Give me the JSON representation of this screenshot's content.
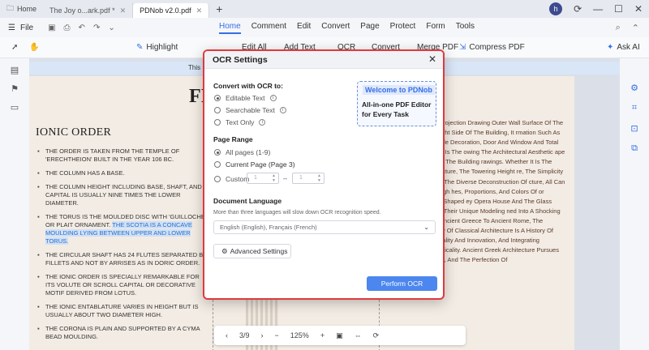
{
  "titlebar": {
    "home_label": "Home",
    "tabs": [
      {
        "label": "The Joy o...ark.pdf *"
      },
      {
        "label": "PDNob v2.0.pdf"
      }
    ],
    "avatar_letter": "h"
  },
  "menubar": {
    "file_label": "File",
    "menus": [
      "Home",
      "Comment",
      "Edit",
      "Convert",
      "Page",
      "Protect",
      "Form",
      "Tools"
    ],
    "active_menu": "Home"
  },
  "toolbar": {
    "highlight": "Highlight",
    "edit_all": "Edit All",
    "add_text": "Add Text",
    "ocr": "OCR",
    "convert": "Convert",
    "merge_pdf": "Merge PDF",
    "compress_pdf": "Compress PDF",
    "ask_ai": "Ask AI"
  },
  "document": {
    "notice": "This PD",
    "title": "FI",
    "heading": "IONIC ORDER",
    "bullets": [
      {
        "text": "THE ORDER IS TAKEN FROM THE TEMPLE OF 'ERECHTHEION' BUILT IN THE YEAR 106 BC."
      },
      {
        "text": "THE COLUMN HAS A BASE."
      },
      {
        "text": "THE COLUMN HEIGHT INCLUDING BASE, SHAFT, AND CAPITAL IS USUALLY NINE TIMES THE LOWER DIAMETER."
      },
      {
        "text": "THE TORUS IS THE MOULDED DISC WITH 'GUILLOCHE' OR PLAIT ORNAMENT.",
        "highlight": "THE SCOTIA IS A CONCAVE MOULDING LYING BETWEEN UPPER AND LOWER TORUS."
      },
      {
        "text": "THE CIRCULAR SHAFT HAS 24 FLUTES SEPARATED BY FILLETS AND NOT BY ARRISES AS IN DORIC ORDER."
      },
      {
        "text": "THE IONIC ORDER IS SPECIALLY REMARKABLE FOR ITS VOLUTE OR SCROLL CAPITAL OR DECORATIVE MOTIF DERIVED FROM LOTUS."
      },
      {
        "text": "THE IONIC ENTABLATURE VARIES IN HEIGHT BUT IS USUALLY ABOUT TWO DIAMETER HIGH."
      },
      {
        "text": "THE CORONA IS PLAIN AND SUPPORTED BY A CYMA BEAD MOULDING."
      }
    ],
    "right_column": "s An Orthographic Projection Drawing Outer Wall Surface Of The Building ; Left Or Right Side Of The Building, It rmation Such As The Building's Facade Decoration, Door And Window And Total Building Height, And Is The owing The Architectural Aesthetic ape The Visual Image Of The Building rawings. Whether It Is The Symmetrical Architecture, The Towering Height re, The Simplicity And Fluency Of , Or The Diverse Deconstruction Of cture, All Can Be Presented Through hes, Proportions, And Colors Of or Example, The Shell-Shaped ey Opera House And The Glass Pyramid re In Paris, Their Unique Modeling ned Into A Shocking Architectural From Ancient Greece To Ancient Rome, The Development History Of Classical Architecture Is A History Of Interweaving Rationality And Innovation, And Integrating Aesthetics And Practicality. Ancient Greek Architecture Pursues Harmony, Proportion, And The Perfection Of"
  },
  "bottomnav": {
    "page_indicator": "3/9",
    "zoom": "125%"
  },
  "dialog": {
    "title": "OCR Settings",
    "convert_title": "Convert with OCR to:",
    "convert_options": [
      {
        "label": "Editable Text",
        "checked": true
      },
      {
        "label": "Searchable Text",
        "checked": false
      },
      {
        "label": "Text Only",
        "checked": false
      }
    ],
    "promo_line1": "Welcome to PDNob",
    "promo_line2": "All-in-one PDF Editor",
    "promo_line3": "for Every Task",
    "page_range_title": "Page Range",
    "page_range_options": [
      {
        "label": "All pages (1-9)",
        "checked": true
      },
      {
        "label": "Current Page (Page 3)",
        "checked": false
      },
      {
        "label": "Custom",
        "checked": false
      }
    ],
    "custom_from": "1",
    "custom_to": "1",
    "language_title": "Document Language",
    "language_help": "More than three languages will slow down OCR recognition speed.",
    "language_value": "English (English), Français (French)",
    "advanced_label": "Advanced Settings",
    "perform_label": "Perform OCR"
  },
  "colors": {
    "accent": "#3470e6",
    "dialog_border": "#e0393e",
    "perform_button": "#4c86ef",
    "page_bg": "#f3ece4"
  }
}
